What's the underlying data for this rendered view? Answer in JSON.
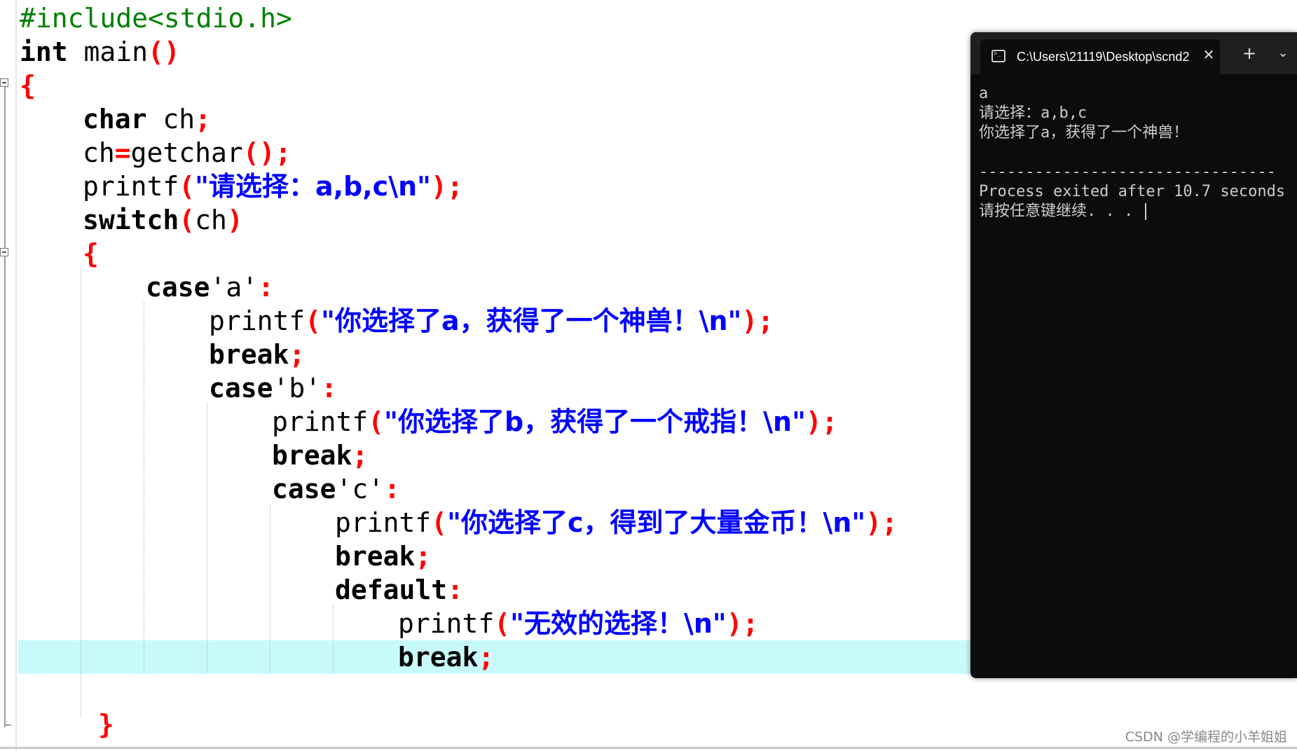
{
  "editor": {
    "lines": [
      [
        {
          "t": "pp",
          "v": "#include<stdio.h>"
        }
      ],
      [
        {
          "t": "kw",
          "v": "int"
        },
        {
          "t": "id",
          "v": " main"
        },
        {
          "t": "op",
          "v": "()"
        }
      ],
      [
        {
          "t": "op",
          "v": "{"
        }
      ],
      [
        {
          "t": "kw",
          "v": "char"
        },
        {
          "t": "id",
          "v": " ch"
        },
        {
          "t": "op",
          "v": ";"
        }
      ],
      [
        {
          "t": "id",
          "v": "ch"
        },
        {
          "t": "op",
          "v": "="
        },
        {
          "t": "id",
          "v": "getchar"
        },
        {
          "t": "op",
          "v": "();"
        }
      ],
      [
        {
          "t": "id",
          "v": "printf"
        },
        {
          "t": "op",
          "v": "("
        },
        {
          "t": "str",
          "v": "\"请选择：a,b,c\\n\""
        },
        {
          "t": "op",
          "v": ");"
        }
      ],
      [
        {
          "t": "kw",
          "v": "switch"
        },
        {
          "t": "op",
          "v": "("
        },
        {
          "t": "id",
          "v": "ch"
        },
        {
          "t": "op",
          "v": ")"
        }
      ],
      [
        {
          "t": "op",
          "v": "{"
        }
      ],
      [
        {
          "t": "kw",
          "v": "case"
        },
        {
          "t": "chr",
          "v": "'a'"
        },
        {
          "t": "op",
          "v": ":"
        }
      ],
      [
        {
          "t": "id",
          "v": "printf"
        },
        {
          "t": "op",
          "v": "("
        },
        {
          "t": "str",
          "v": "\"你选择了a，获得了一个神兽！\\n\""
        },
        {
          "t": "op",
          "v": ");"
        }
      ],
      [
        {
          "t": "kw",
          "v": "break"
        },
        {
          "t": "op",
          "v": ";"
        }
      ],
      [
        {
          "t": "kw",
          "v": "case"
        },
        {
          "t": "chr",
          "v": "'b'"
        },
        {
          "t": "op",
          "v": ":"
        }
      ],
      [
        {
          "t": "id",
          "v": "printf"
        },
        {
          "t": "op",
          "v": "("
        },
        {
          "t": "str",
          "v": "\"你选择了b，获得了一个戒指！\\n\""
        },
        {
          "t": "op",
          "v": ");"
        }
      ],
      [
        {
          "t": "kw",
          "v": "break"
        },
        {
          "t": "op",
          "v": ";"
        }
      ],
      [
        {
          "t": "kw",
          "v": "case"
        },
        {
          "t": "chr",
          "v": "'c'"
        },
        {
          "t": "op",
          "v": ":"
        }
      ],
      [
        {
          "t": "id",
          "v": "printf"
        },
        {
          "t": "op",
          "v": "("
        },
        {
          "t": "str",
          "v": "\"你选择了c，得到了大量金币！\\n\""
        },
        {
          "t": "op",
          "v": ");"
        }
      ],
      [
        {
          "t": "kw",
          "v": "break"
        },
        {
          "t": "op",
          "v": ";"
        }
      ],
      [
        {
          "t": "kw",
          "v": "default"
        },
        {
          "t": "op",
          "v": ":"
        }
      ],
      [
        {
          "t": "id",
          "v": "printf"
        },
        {
          "t": "op",
          "v": "("
        },
        {
          "t": "str",
          "v": "\"无效的选择！\\n\""
        },
        {
          "t": "op",
          "v": ");"
        }
      ],
      [
        {
          "t": "kw",
          "v": "break"
        },
        {
          "t": "op",
          "v": ";"
        }
      ],
      [],
      [
        {
          "t": "op",
          "v": "}"
        }
      ]
    ],
    "highlighted_line": 20,
    "colors": {
      "preprocessor": "#008000",
      "keyword": "#000000",
      "operator": "#ff0000",
      "string": "#0000ff",
      "current_line": "#c8fafa"
    }
  },
  "terminal": {
    "tab_title": "C:\\Users\\21119\\Desktop\\scnd2",
    "tab_icon": "terminal-icon",
    "close_glyph": "✕",
    "new_tab_glyph": "+",
    "dropdown_glyph": "⌄",
    "lines": [
      "a",
      "请选择：a,b,c",
      "你选择了a，获得了一个神兽！",
      "",
      "--------------------------------",
      "Process exited after 10.7 seconds",
      "请按任意键继续. . . "
    ]
  },
  "watermark": "CSDN @学编程的小羊姐姐"
}
